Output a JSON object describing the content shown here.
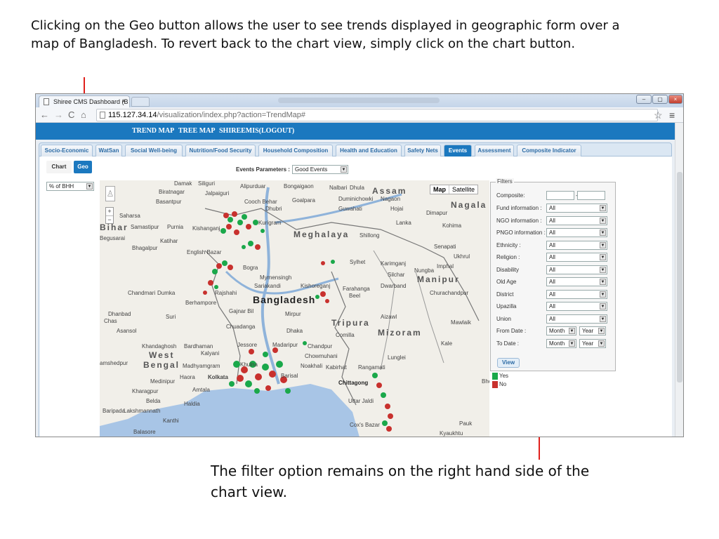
{
  "slide": {
    "caption_top": "Clicking on the Geo button allows the user to see trends displayed in geographic form over a map of Bangladesh. To revert back to the chart view, simply click on the chart button.",
    "caption_bottom": "The filter option remains on the right hand side of the chart view."
  },
  "browser": {
    "tab_title": "Shiree CMS Dashboard (B",
    "tab_close": "×",
    "url_host": "115.127.34.14",
    "url_path": "/visualization/index.php?action=TrendMap#",
    "win_min": "–",
    "win_max": "▢",
    "win_close": "×"
  },
  "app": {
    "nav": [
      "TREND MAP",
      "TREE MAP",
      "SHIREEMIS(LOGOUT)"
    ],
    "tabs": [
      "Socio-Economic",
      "WatSan",
      "Social Well-being",
      "Nutrition/Food Security",
      "Household Composition",
      "Health and Education",
      "Safety Nets",
      "Events",
      "Assessment",
      "Composite Indicator"
    ],
    "active_tab": "Events",
    "chart_button": "Chart",
    "geo_button": "Geo",
    "indicator_select": "% of BHH",
    "events_params_label": "Events Parameters :",
    "events_params_value": "Good Events"
  },
  "map": {
    "map_button": "Map",
    "satellite_button": "Satellite",
    "zoom_in": "+",
    "zoom_out": "−",
    "labels": {
      "country": "Bangladesh",
      "assam": "Assam",
      "meghalaya": "Meghalaya",
      "nagaland": "Nagala",
      "manipur": "Manipur",
      "tripura": "Tripura",
      "mizoram": "Mizoram",
      "bihar": "Bihar",
      "west_bengal_1": "West",
      "west_bengal_2": "Bengal",
      "cities": [
        "Damak",
        "Siliguri",
        "Biratnagar",
        "Jalpaiguri",
        "Alipurduar",
        "Bongaigaon",
        "Nalbari",
        "Dhula",
        "Basantpur",
        "Cooch Behar",
        "Goalpara",
        "Duminichowki",
        "Nagaon",
        "Saharsa",
        "Dhubri",
        "Guwahati",
        "Hojai",
        "Dimapur",
        "Samastipur",
        "Purnia",
        "Kishanganj",
        "Kurigram",
        "Lanka",
        "Kohima",
        "Begusarai",
        "Katihar",
        "Shillong",
        "Bhagalpur",
        "Senapati",
        "English Bazar",
        "Ukhrul",
        "Sylhet",
        "Karimganj",
        "Nungba",
        "Imphal",
        "Bogra",
        "Mymensingh",
        "Silchar",
        "Dwarband",
        "Sariakandi",
        "Kishoreganj",
        "Farahanga",
        "Beel",
        "Chandmari",
        "Dumka",
        "Rajshahi",
        "Berhampore",
        "Churachandpur",
        "Gajnar Bil",
        "Dhanbad",
        "Chas",
        "Suri",
        "Mirpur",
        "Aizawl",
        "Mawlaik",
        "Chuadanga",
        "Dhaka",
        "Asansol",
        "Comilla",
        "Khandaghosh",
        "Bardhaman",
        "Jessore",
        "Madaripur",
        "Chandpur",
        "Kalyani",
        "Chowmuhani",
        "Kale",
        "amshedpur",
        "Madhyamgram",
        "Khulna",
        "Noakhali",
        "Kabirhat",
        "Lunglei",
        "Medinipur",
        "Haora",
        "Kolkata",
        "Barisal",
        "Rangamati",
        "Kharagpur",
        "Amtala",
        "Bhola",
        "Chittagong",
        "Belda",
        "Haldia",
        "Uttar Jaldi",
        "Baripada",
        "Lakshmannath",
        "Kanthi",
        "Cox's Bazar",
        "Pauk",
        "Balasore",
        "Kyaukhtu"
      ]
    }
  },
  "filters": {
    "legend": "Filters",
    "composite_label": "Composite:",
    "composite_sep": "-",
    "rows": [
      {
        "label": "Fund information :",
        "value": "All"
      },
      {
        "label": "NGO information :",
        "value": "All"
      },
      {
        "label": "PNGO information :",
        "value": "All"
      },
      {
        "label": "Ethnicity :",
        "value": "All"
      },
      {
        "label": "Religion :",
        "value": "All"
      },
      {
        "label": "Disability",
        "value": "All"
      },
      {
        "label": "Old Age",
        "value": "All"
      },
      {
        "label": "District",
        "value": "All"
      },
      {
        "label": "Upazilla",
        "value": "All"
      },
      {
        "label": "Union",
        "value": "All"
      }
    ],
    "from_date_label": "From Date :",
    "to_date_label": "To Date :",
    "month": "Month",
    "year": "Year",
    "view_button": "View"
  },
  "legend": {
    "yes": "Yes",
    "no": "No",
    "yes_color": "#1aa84a",
    "no_color": "#c8312e"
  },
  "colors": {
    "header_blue": "#1b78bf",
    "arrow_red": "#e0201c"
  }
}
